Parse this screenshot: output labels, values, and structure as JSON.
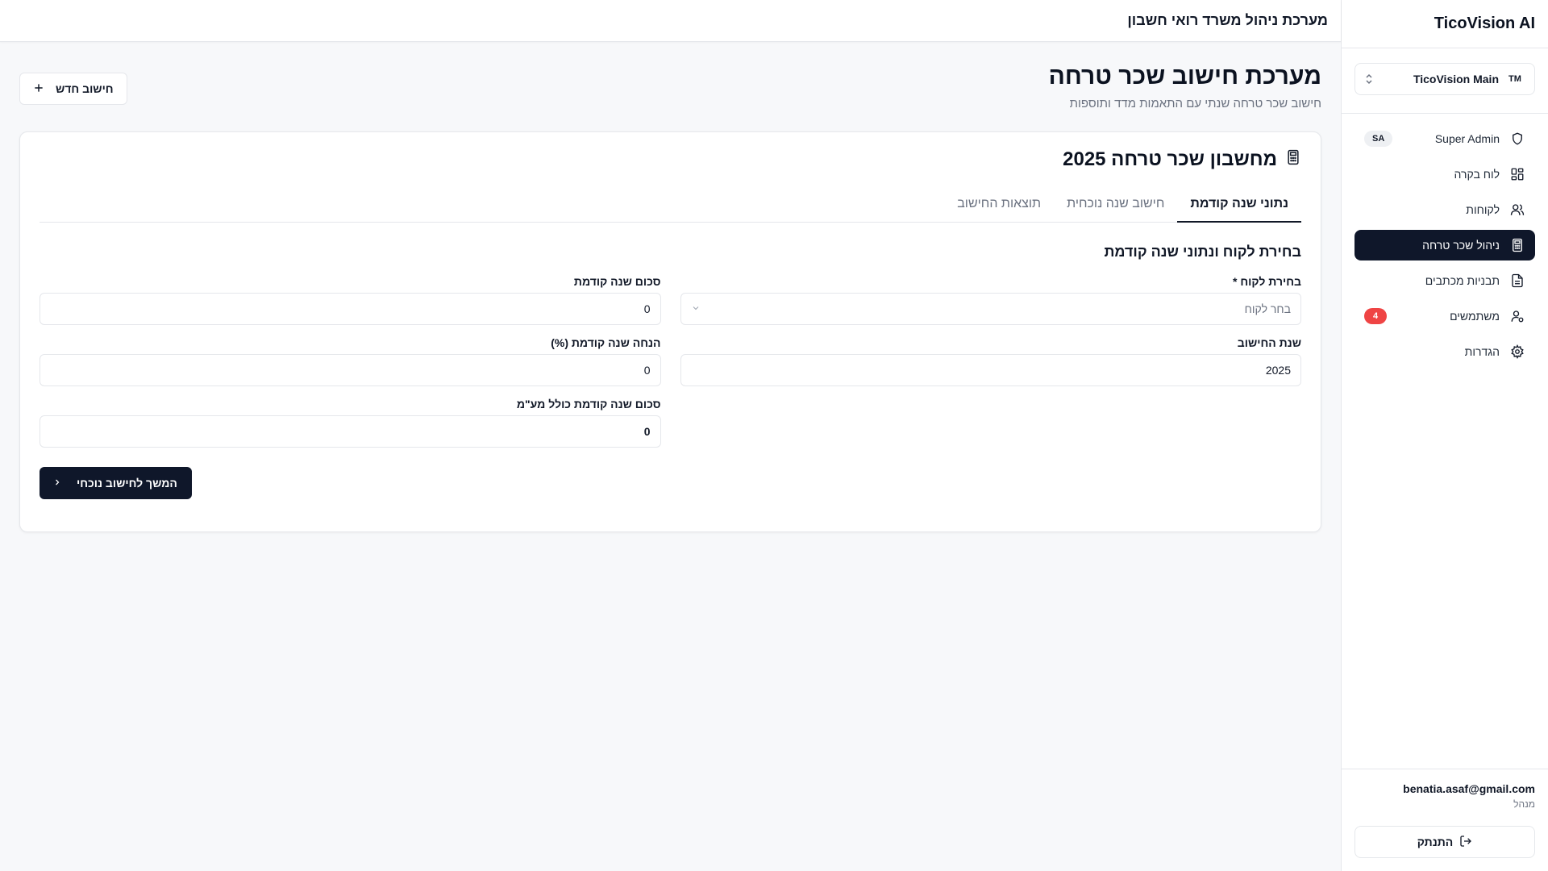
{
  "sidebar": {
    "brand": "TicoVision AI",
    "workspace": {
      "avatar": "TM",
      "name": "TicoVision Main"
    },
    "items": [
      {
        "label": "Super Admin",
        "icon": "shield-icon",
        "badge": "SA"
      },
      {
        "label": "לוח בקרה",
        "icon": "dashboard-icon"
      },
      {
        "label": "לקוחות",
        "icon": "users-icon"
      },
      {
        "label": "ניהול שכר טרחה",
        "icon": "calculator-icon",
        "active": true
      },
      {
        "label": "תבניות מכתבים",
        "icon": "document-icon"
      },
      {
        "label": "משתמשים",
        "icon": "user-cog-icon",
        "badge": "4"
      },
      {
        "label": "הגדרות",
        "icon": "gear-icon"
      }
    ],
    "user": {
      "email": "benatia.asaf@gmail.com",
      "role": "מנהל"
    },
    "logout_label": "התנתק"
  },
  "header": {
    "title": "מערכת ניהול משרד רואי חשבון"
  },
  "page": {
    "title": "מערכת חישוב שכר טרחה",
    "subtitle": "חישוב שכר טרחה שנתי עם התאמות מדד ותוספות",
    "new_button": "חישוב חדש"
  },
  "card": {
    "title": "מחשבון שכר טרחה 2025",
    "tabs": [
      "נתוני שנה קודמת",
      "חישוב שנה נוכחית",
      "תוצאות החישוב"
    ],
    "section_title": "בחירת לקוח ונתוני שנה קודמת",
    "fields": {
      "client": {
        "label": "בחירת לקוח *",
        "placeholder": "בחר לקוח"
      },
      "prev_amount": {
        "label": "סכום שנה קודמת",
        "value": "0"
      },
      "calc_year": {
        "label": "שנת החישוב",
        "value": "2025"
      },
      "prev_discount": {
        "label": "הנחה שנה קודמת (%)",
        "value": "0"
      },
      "prev_amount_vat": {
        "label": "סכום שנה קודמת כולל מע\"מ",
        "value": "0"
      }
    },
    "continue_button": "המשך לחישוב נוכחי"
  },
  "colors": {
    "primary": "#0f172a",
    "badge": "#ef4444",
    "background": "#f7f8fa"
  }
}
